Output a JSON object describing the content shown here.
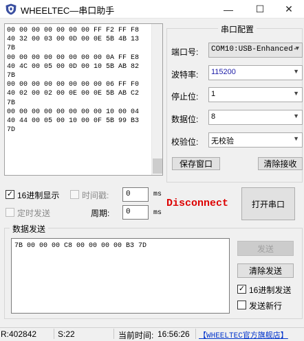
{
  "window": {
    "title": "WHEELTEC—串口助手",
    "minimize": "—",
    "maximize": "☐",
    "close": "✕"
  },
  "receive": {
    "text": "00 00 00 00 00 00 00 FF F2 FF F8\n40 32 00 03 00 0D 00 0E 5B 4B 13\n7B\n00 00 00 00 00 00 00 00 0A FF E8\n40 4C 00 05 00 0D 00 10 5B AB 82\n7B\n00 00 00 00 00 00 00 00 06 FF F0\n40 02 00 02 00 0E 00 0E 5B AB C2\n7B\n00 00 00 00 00 00 00 00 10 00 04\n40 44 00 05 00 10 00 0F 5B 99 B3\n7D"
  },
  "port_config": {
    "title": "串口配置",
    "port_label": "端口号:",
    "port_value": "COM10:USB-Enhanced-",
    "baud_label": "波特率:",
    "baud_value": "115200",
    "stop_label": "停止位:",
    "stop_value": "1",
    "data_label": "数据位:",
    "data_value": "8",
    "parity_label": "校验位:",
    "parity_value": "无校验",
    "save_window": "保存窗口",
    "clear_receive": "清除接收"
  },
  "controls": {
    "hex_display": "16进制显示",
    "hex_display_checked": true,
    "timestamp": "时间戳:",
    "timestamp_value": "0",
    "timestamp_unit": "ms",
    "timed_send": "定时发送",
    "period": "周期:",
    "period_value": "0",
    "period_unit": "ms",
    "status": "Disconnect",
    "open_port": "打开串口"
  },
  "send": {
    "group_title": "数据发送",
    "text": "7B 00 00 00 C8 00 00 00 00 B3 7D",
    "send_button": "发送",
    "clear_send": "清除发送",
    "hex_send": "16进制发送",
    "hex_send_checked": true,
    "send_newline": "发送新行",
    "send_newline_checked": false
  },
  "status_bar": {
    "received": "R:402842",
    "sent": "S:22",
    "time_label": "当前时间:",
    "time_value": "16:56:26",
    "store_link": "【WHEELTEC官方旗舰店】"
  },
  "colors": {
    "status_red": "#dd0000",
    "baud_blue": "#1a1aa6",
    "link_blue": "#0033cc"
  }
}
